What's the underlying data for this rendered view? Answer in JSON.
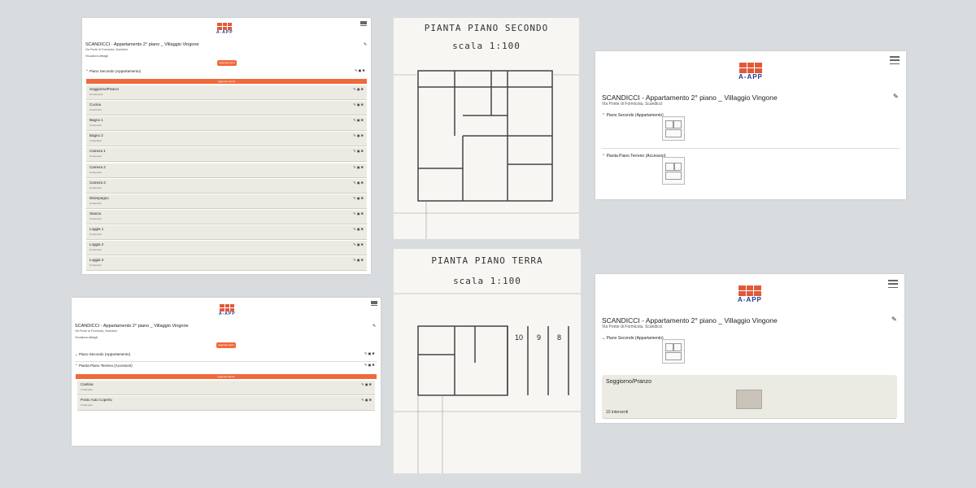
{
  "app": {
    "logo_text": "A-APP",
    "brand_color": "#233a8f",
    "accent": "#ef6a3a"
  },
  "property": {
    "title": "SCANDICCI - Appartamento 2° piano _ Villaggio Vingone",
    "address": "Via Ponte di Formicola, Scandicci"
  },
  "panel1": {
    "info": "Visualizza dettagli",
    "button": "Aggiungi piano",
    "level": "Piano Secondo (Appartamento)",
    "bar": "Aggiungi stanza",
    "rooms": [
      {
        "name": "Soggiorno/Pranzo",
        "sub": "10 interventi"
      },
      {
        "name": "Cucina",
        "sub": "3 interventi"
      },
      {
        "name": "Bagno 1",
        "sub": "3 interventi"
      },
      {
        "name": "Bagno 2",
        "sub": "3 interventi"
      },
      {
        "name": "Camera 1",
        "sub": "3 interventi"
      },
      {
        "name": "Camera 2",
        "sub": "3 interventi"
      },
      {
        "name": "Camera 3",
        "sub": "3 interventi"
      },
      {
        "name": "Disimpegno",
        "sub": "3 interventi"
      },
      {
        "name": "Stanza",
        "sub": "3 interventi"
      },
      {
        "name": "Loggia 1",
        "sub": "3 interventi"
      },
      {
        "name": "Loggia 2",
        "sub": "3 interventi"
      },
      {
        "name": "Loggia 3",
        "sub": "3 interventi"
      }
    ]
  },
  "panel2": {
    "info": "Visualizza dettagli",
    "button": "Aggiungi piano",
    "levels": [
      "Piano Secondo (Appartamento)",
      "Pianta Piano Terreno (Accessori)"
    ],
    "bar": "Aggiungi stanza",
    "rooms": [
      {
        "name": "Cantina",
        "sub": "3 interventi"
      },
      {
        "name": "Posto Auto Coperto",
        "sub": "3 interventi"
      }
    ]
  },
  "plan1": {
    "title": "PIANTA PIANO SECONDO",
    "scale": "scala 1:100"
  },
  "plan2": {
    "title": "PIANTA PIANO TERRA",
    "scale": "scala 1:100",
    "spots": [
      "10",
      "9",
      "8"
    ]
  },
  "panel3": {
    "levels": [
      "Piano Secondo (Appartamento)",
      "Pianta Piano Terreno (Accessori)"
    ]
  },
  "panel4": {
    "level": "Piano Secondo (Appartamento)",
    "room": {
      "name": "Soggiorno/Pranzo",
      "sub": "10 interventi"
    }
  },
  "icons": {
    "edit": "pencil-icon",
    "image": "image-icon",
    "delete": "trash-icon",
    "menu": "hamburger-icon"
  }
}
